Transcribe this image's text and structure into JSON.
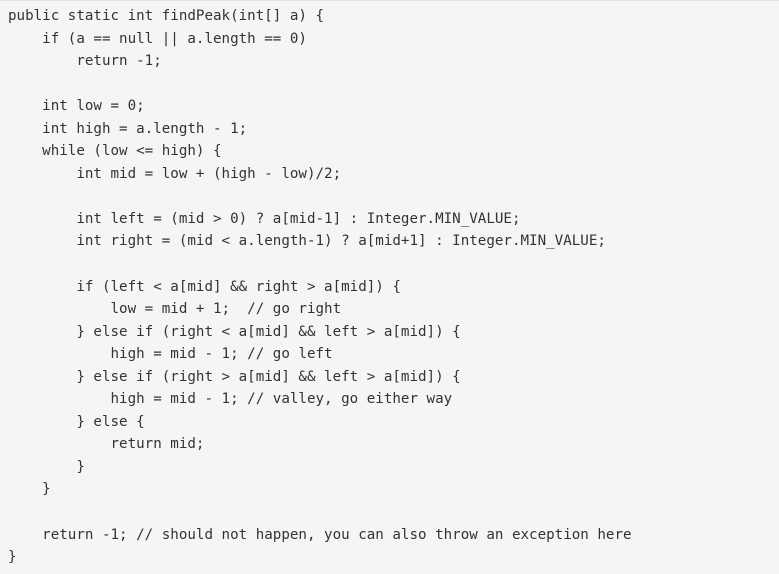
{
  "code": {
    "lines": [
      "public static int findPeak(int[] a) {",
      "    if (a == null || a.length == 0)",
      "        return -1;",
      "",
      "    int low = 0;",
      "    int high = a.length - 1;",
      "    while (low <= high) {",
      "        int mid = low + (high - low)/2;",
      "",
      "        int left = (mid > 0) ? a[mid-1] : Integer.MIN_VALUE;",
      "        int right = (mid < a.length-1) ? a[mid+1] : Integer.MIN_VALUE;",
      "",
      "        if (left < a[mid] && right > a[mid]) {",
      "            low = mid + 1;  // go right",
      "        } else if (right < a[mid] && left > a[mid]) {",
      "            high = mid - 1; // go left",
      "        } else if (right > a[mid] && left > a[mid]) {",
      "            high = mid - 1; // valley, go either way",
      "        } else {",
      "            return mid;",
      "        }",
      "    }",
      "",
      "    return -1; // should not happen, you can also throw an exception here",
      "}"
    ]
  }
}
